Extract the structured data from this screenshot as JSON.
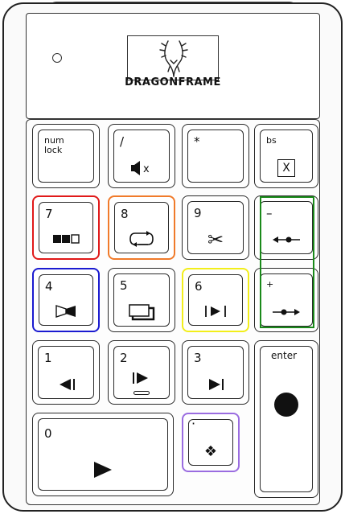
{
  "brand": {
    "name": "DRAGONFRAME"
  },
  "keys": {
    "numlock": {
      "label": "num\nlock",
      "icon": "none"
    },
    "slash": {
      "label": "/",
      "icon": "mute-icon",
      "glyph": "◀x"
    },
    "asterisk": {
      "label": "*",
      "icon": "none"
    },
    "bs": {
      "label": "bs",
      "glyph": "X",
      "icon": "delete-frame-icon"
    },
    "k7": {
      "label": "7",
      "icon": "frame-blocks-icon"
    },
    "k8": {
      "label": "8",
      "icon": "loop-icon"
    },
    "k9": {
      "label": "9",
      "icon": "scissors-icon",
      "glyph": "✂"
    },
    "minus": {
      "label": "–",
      "icon": "step-back-arrow-icon"
    },
    "k4": {
      "label": "4",
      "icon": "half-blackout-icon"
    },
    "k5": {
      "label": "5",
      "icon": "stacked-frames-icon"
    },
    "k6": {
      "label": "6",
      "icon": "play-between-bars-icon",
      "glyph": "|▶|"
    },
    "plus": {
      "label": "+",
      "icon": "step-forward-arrow-icon"
    },
    "k1": {
      "label": "1",
      "icon": "step-back-icon",
      "glyph": "◀|"
    },
    "k2": {
      "label": "2",
      "icon": "step-forward-icon",
      "glyph": "|▶"
    },
    "k3": {
      "label": "3",
      "icon": "skip-end-icon",
      "glyph": "▶|"
    },
    "enter": {
      "label": "enter",
      "icon": "capture-dot-icon"
    },
    "k0": {
      "label": "0",
      "icon": "play-icon",
      "glyph": "▶"
    },
    "dot": {
      "label": "·",
      "icon": "diamond-icon",
      "glyph": "❖"
    }
  },
  "highlights": {
    "red": "#e01818",
    "orange": "#f07a2a",
    "blue": "#1a1ad0",
    "yellow": "#f2ee1a",
    "green": "#1a8a1a",
    "purple": "#9a6ce0"
  }
}
